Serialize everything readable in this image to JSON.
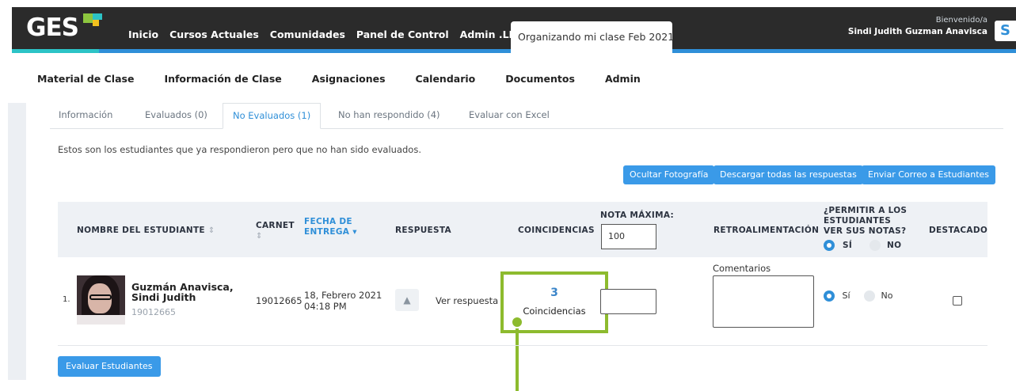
{
  "header": {
    "logo_text": "GES",
    "nav": [
      "Inicio",
      "Cursos Actuales",
      "Comunidades",
      "Panel de Control",
      "Admin .LRN"
    ],
    "active_tab": "Organizando mi clase Feb 2021",
    "welcome_label": "Bienvenido/a",
    "user_name": "Sindi Judith Guzman Anavisca",
    "avatar_letter": "S"
  },
  "subnav": [
    "Material de Clase",
    "Información de Clase",
    "Asignaciones",
    "Calendario",
    "Documentos",
    "Admin"
  ],
  "tabs": [
    "Información",
    "Evaluados (0)",
    "No Evaluados (1)",
    "No han respondido (4)",
    "Evaluar con Excel"
  ],
  "note": "Estos son los estudiantes que ya respondieron pero que no han sido evaluados.",
  "buttons": {
    "hide_photo": "Ocultar Fotografía",
    "download_all": "Descargar todas las respuestas",
    "email_students": "Enviar Correo a Estudiantes",
    "evaluate": "Evaluar Estudiantes"
  },
  "table": {
    "headers": {
      "student": "NOMBRE DEL ESTUDIANTE",
      "carnet": "CARNET",
      "fecha_1": "FECHA DE",
      "fecha_2": "ENTREGA",
      "respuesta": "RESPUESTA",
      "coincidencias": "COINCIDENCIAS",
      "nota_max": "NOTA MÁXIMA:",
      "nota_max_value": "100",
      "retro": "RETROALIMENTACIÓN",
      "permit_1": "¿PERMITIR A LOS",
      "permit_2": "ESTUDIANTES",
      "permit_3": "VER SUS NOTAS?",
      "permit_yes": "SÍ",
      "permit_no": "NO",
      "destacado": "DESTACADO"
    },
    "rows": [
      {
        "index": "1.",
        "name_1": "Guzmán Anavisca,",
        "name_2": "Sindi Judith",
        "carnet_sub": "19012665",
        "carnet": "19012665",
        "date_1": "18, Febrero 2021",
        "date_2": "04:18 PM",
        "response_link": "Ver respuesta",
        "matches": "3",
        "matches_label": "Coincidencias",
        "comment_label": "Comentarios",
        "permit_yes": "Sí",
        "permit_no": "No"
      }
    ]
  },
  "colors": {
    "header_bg": "#2b2b2b",
    "accent_blue": "#2f8fd8",
    "highlight_green": "#8dbb2e"
  }
}
